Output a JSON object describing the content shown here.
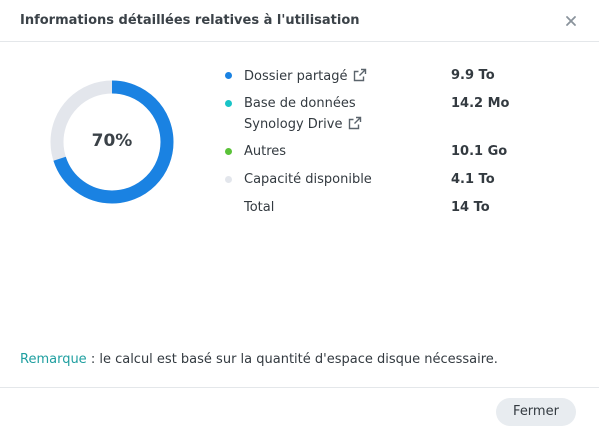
{
  "dialog": {
    "title": "Informations détaillées relatives à l'utilisation",
    "close_icon": "close-icon"
  },
  "usage": {
    "percent": 70,
    "percent_label": "70%",
    "colors": {
      "used": "#1a82e2",
      "track": "#e3e6ec"
    }
  },
  "legend": {
    "items": [
      {
        "label": "Dossier partagé",
        "label_line2": "",
        "value": "9.9 To",
        "color": "#1a82e2",
        "link_icon": "external-link-icon"
      },
      {
        "label": "Base de données",
        "label_line2": "Synology Drive",
        "value": "14.2 Mo",
        "color": "#19c4c7",
        "link_icon": "external-link-icon"
      },
      {
        "label": "Autres",
        "label_line2": "",
        "value": "10.1 Go",
        "color": "#5ac238",
        "link_icon": ""
      },
      {
        "label": "Capacité disponible",
        "label_line2": "",
        "value": "4.1 To",
        "color": "#e3e6ec",
        "link_icon": ""
      },
      {
        "label": "Total",
        "label_line2": "",
        "value": "14 To",
        "color": "",
        "link_icon": ""
      }
    ]
  },
  "note": {
    "lead": "Remarque",
    "text": " : le calcul est basé sur la quantité d'espace disque nécessaire."
  },
  "footer": {
    "close_label": "Fermer"
  }
}
